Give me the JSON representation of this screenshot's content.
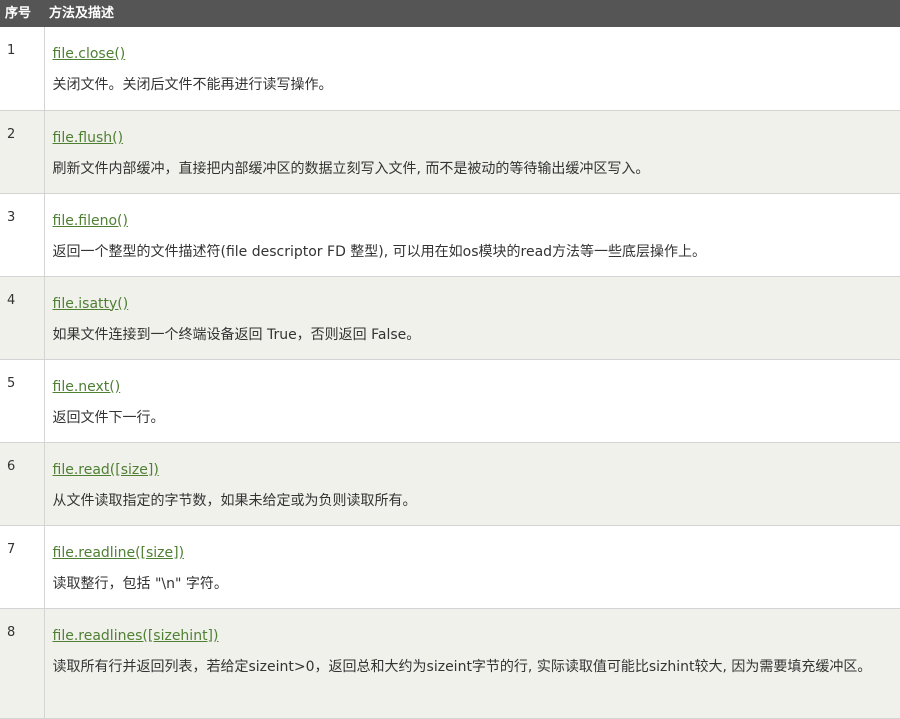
{
  "header": {
    "number_label": "序号",
    "desc_label": "方法及描述"
  },
  "rows": [
    {
      "num": "1",
      "method": "file.close()",
      "desc": "关闭文件。关闭后文件不能再进行读写操作。"
    },
    {
      "num": "2",
      "method": "file.flush()",
      "desc": "刷新文件内部缓冲，直接把内部缓冲区的数据立刻写入文件, 而不是被动的等待输出缓冲区写入。"
    },
    {
      "num": "3",
      "method": "file.fileno()",
      "desc": "返回一个整型的文件描述符(file descriptor FD 整型), 可以用在如os模块的read方法等一些底层操作上。"
    },
    {
      "num": "4",
      "method": "file.isatty()",
      "desc": "如果文件连接到一个终端设备返回 True，否则返回 False。"
    },
    {
      "num": "5",
      "method": "file.next()",
      "desc": "返回文件下一行。"
    },
    {
      "num": "6",
      "method": "file.read([size])",
      "desc": "从文件读取指定的字节数，如果未给定或为负则读取所有。"
    },
    {
      "num": "7",
      "method": "file.readline([size])",
      "desc": "读取整行，包括 \"\\n\" 字符。"
    },
    {
      "num": "8",
      "method": "file.readlines([sizehint])",
      "desc": "读取所有行并返回列表，若给定sizeint>0，返回总和大约为sizeint字节的行, 实际读取值可能比sizhint较大, 因为需要填充缓冲区。"
    }
  ],
  "colors": {
    "header_bg": "#555555",
    "row_alt_bg": "#f1f1ec",
    "link": "#4f7f33"
  }
}
